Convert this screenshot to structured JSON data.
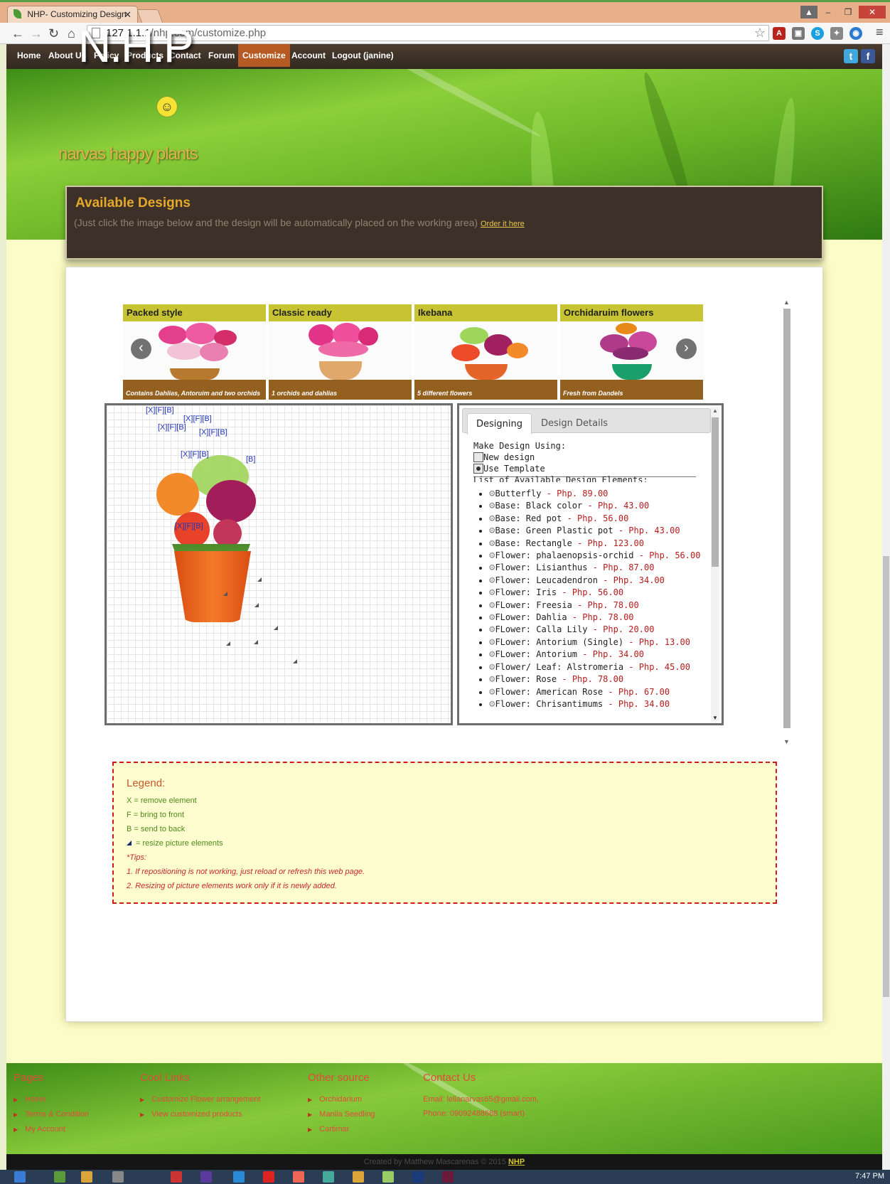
{
  "browser": {
    "tab_title": "NHP- Customizing Design",
    "url_host": "127.1.1.1",
    "url_path": "/nhp.com/customize.php"
  },
  "nav": {
    "items": [
      "Home",
      "About Us",
      "Policy",
      "Products",
      "Contact",
      "Forum",
      "Customize",
      "Account",
      "Logout (janine)"
    ],
    "active": "Customize"
  },
  "brand": {
    "logo": "N.H.P",
    "tagline": "narvas happy plants"
  },
  "banner": {
    "title": "Available Designs",
    "subtitle": "(Just click the image below and the design will be automatically placed on the working area)",
    "link": "Order it here"
  },
  "designs": [
    {
      "title": "Packed style",
      "caption": "Contains Dahlias, Antoruim and two orchids"
    },
    {
      "title": "Classic ready",
      "caption": "1 orchids and dahlias"
    },
    {
      "title": "Ikebana",
      "caption": "5 different flowers"
    },
    {
      "title": "Orchidaruim flowers",
      "caption": "Fresh from Dandels"
    }
  ],
  "workarea": {
    "control_label": "[X][F][B]",
    "partial_label": "[B]"
  },
  "designer": {
    "tabs": [
      "Designing",
      "Design Details"
    ],
    "make_label": "Make Design Using:",
    "options": [
      "New design",
      "Use Template"
    ],
    "selected_option": "Use Template",
    "list_header": "List of Available Design Elements:",
    "elements": [
      {
        "name": "Butterfly",
        "price": "Php. 89.00"
      },
      {
        "name": "Base: Black color",
        "price": "Php. 43.00"
      },
      {
        "name": "Base: Red pot",
        "price": "Php. 56.00"
      },
      {
        "name": "Base: Green Plastic pot",
        "price": "Php. 43.00"
      },
      {
        "name": "Base: Rectangle",
        "price": "Php. 123.00"
      },
      {
        "name": "Flower: phalaenopsis-orchid",
        "price": "Php. 56.00"
      },
      {
        "name": "Flower: Lisianthus",
        "price": "Php. 87.00"
      },
      {
        "name": "Flower: Leucadendron",
        "price": "Php. 34.00"
      },
      {
        "name": "Flower: Iris",
        "price": "Php. 56.00"
      },
      {
        "name": "FLower: Freesia",
        "price": "Php. 78.00"
      },
      {
        "name": "FLower: Dahlia",
        "price": "Php. 78.00"
      },
      {
        "name": "FLower: Calla Lily",
        "price": "Php. 20.00"
      },
      {
        "name": "FLower: Antorium (Single)",
        "price": "Php. 13.00"
      },
      {
        "name": "FLower: Antorium",
        "price": "Php. 34.00"
      },
      {
        "name": "Flower/ Leaf: Alstromeria",
        "price": "Php. 45.00"
      },
      {
        "name": "Flower: Rose",
        "price": "Php. 78.00"
      },
      {
        "name": "Flower: American Rose",
        "price": "Php. 67.00"
      },
      {
        "name": "Flower: Chrisantimums",
        "price": "Php. 34.00"
      }
    ]
  },
  "legend": {
    "title": "Legend:",
    "x": "X = remove element",
    "f": "F = bring to front",
    "b": "B = send to back",
    "resize": "= resize picture elements",
    "tips_label": "*Tips:",
    "tip1": "1. If repositioning is not working, just reload or refresh this web page.",
    "tip2": "2. Resizing of picture elements work only if it is newly added."
  },
  "footer": {
    "pages": {
      "title": "Pages",
      "items": [
        "Home",
        "Terms & Condition",
        "My Account"
      ]
    },
    "cool": {
      "title": "Cool Links",
      "items": [
        "Customize Flower arrangement",
        "View customized products"
      ]
    },
    "other": {
      "title": "Other source",
      "items": [
        "Orchidarium",
        "Manila Seedling",
        "Cartimar"
      ]
    },
    "contact": {
      "title": "Contact Us",
      "email": "Email: lelianarvas65@gmail.com,",
      "phone": "Phone: 09092488688 (smart)"
    },
    "credit": "Created by Matthew Mascarenas © 2015",
    "credit_link": "NHP"
  },
  "taskbar": {
    "clock": "7:47 PM"
  },
  "colors": {
    "accent": "#c7c332",
    "nav_bg": "#3a2f25",
    "price": "#b71c1c",
    "legend_border": "#d11a1a"
  }
}
